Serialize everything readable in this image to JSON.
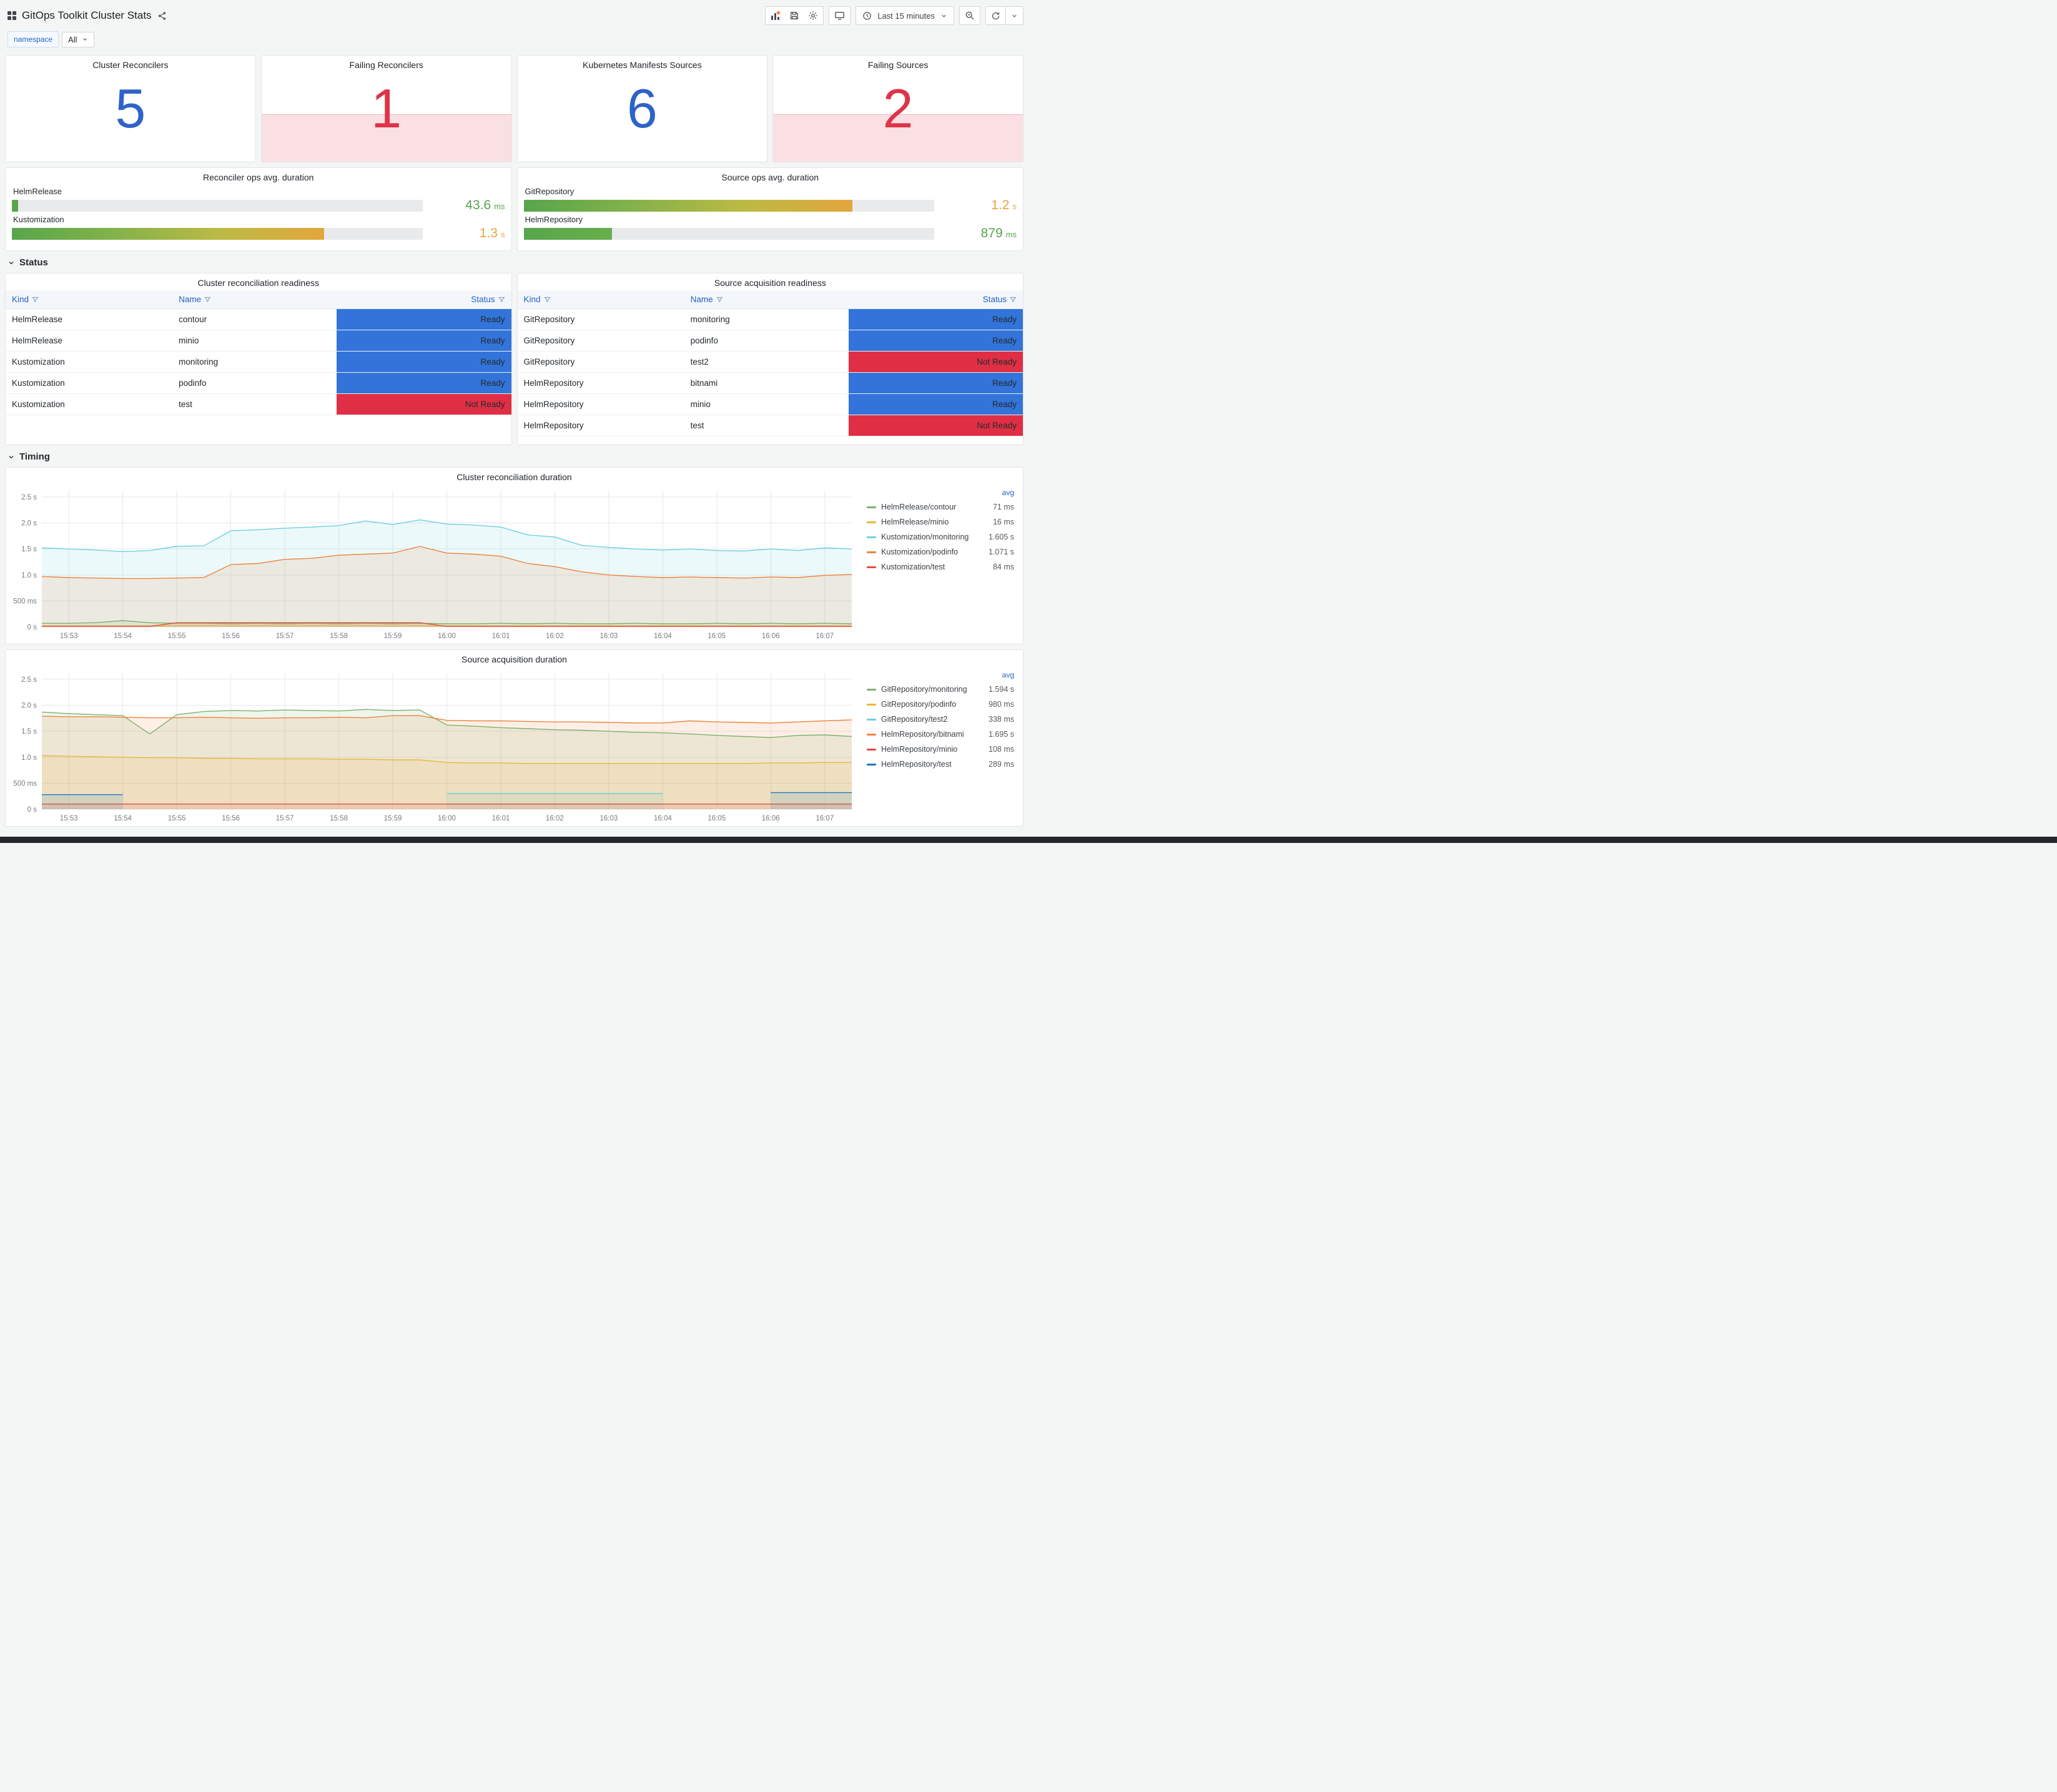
{
  "header": {
    "title": "GitOps Toolkit Cluster Stats",
    "time_range": "Last 15 minutes"
  },
  "variables": {
    "label": "namespace",
    "value": "All"
  },
  "colors": {
    "stat-blue": "#2E63C8",
    "alert-red": "#DE3449",
    "alert-bg": "rgba(224,47,68,0.15)",
    "ready-blue": "#3274D9",
    "notready-red": "#E02F44",
    "link-blue": "#1F62C4",
    "value-green": "#56A64B",
    "value-orange": "#E9A23B"
  },
  "stat_panels": [
    {
      "title": "Cluster Reconcilers",
      "value": "5",
      "state": "normal"
    },
    {
      "title": "Failing Reconcilers",
      "value": "1",
      "state": "alerting"
    },
    {
      "title": "Kubernetes Manifests Sources",
      "value": "6",
      "state": "normal"
    },
    {
      "title": "Failing Sources",
      "value": "2",
      "state": "alerting"
    }
  ],
  "gauge_panels": [
    {
      "title": "Reconciler ops avg. duration",
      "rows": [
        {
          "label": "HelmRelease",
          "value": "43.6",
          "unit": "ms",
          "pct": 1.5,
          "value_color": "#56A64B",
          "bar_colors": [
            "#57A64B",
            "#57A64B"
          ]
        },
        {
          "label": "Kustomization",
          "value": "1.3",
          "unit": "s",
          "pct": 76,
          "value_color": "#E9A23B",
          "bar_colors": [
            "#57A64B",
            "#84B24A",
            "#BCBA44",
            "#E2A63C"
          ]
        }
      ]
    },
    {
      "title": "Source ops avg. duration",
      "rows": [
        {
          "label": "GitRepository",
          "value": "1.2",
          "unit": "s",
          "pct": 80,
          "value_color": "#E9A23B",
          "bar_colors": [
            "#57A64B",
            "#84B24A",
            "#BCBA44",
            "#E2A63C"
          ]
        },
        {
          "label": "HelmRepository",
          "value": "879",
          "unit": "ms",
          "pct": 21.5,
          "value_color": "#56A64B",
          "bar_colors": [
            "#57A64B",
            "#68AE4C"
          ]
        }
      ]
    }
  ],
  "sections": {
    "status": "Status",
    "timing": "Timing"
  },
  "table_panels": [
    {
      "title": "Cluster reconciliation readiness",
      "columns": [
        "Kind",
        "Name",
        "Status"
      ],
      "rows": [
        {
          "kind": "HelmRelease",
          "name": "contour",
          "status": "Ready"
        },
        {
          "kind": "HelmRelease",
          "name": "minio",
          "status": "Ready"
        },
        {
          "kind": "Kustomization",
          "name": "monitoring",
          "status": "Ready"
        },
        {
          "kind": "Kustomization",
          "name": "podinfo",
          "status": "Ready"
        },
        {
          "kind": "Kustomization",
          "name": "test",
          "status": "Not Ready"
        }
      ]
    },
    {
      "title": "Source acquisition readiness",
      "columns": [
        "Kind",
        "Name",
        "Status"
      ],
      "rows": [
        {
          "kind": "GitRepository",
          "name": "monitoring",
          "status": "Ready"
        },
        {
          "kind": "GitRepository",
          "name": "podinfo",
          "status": "Ready"
        },
        {
          "kind": "GitRepository",
          "name": "test2",
          "status": "Not Ready"
        },
        {
          "kind": "HelmRepository",
          "name": "bitnami",
          "status": "Ready"
        },
        {
          "kind": "HelmRepository",
          "name": "minio",
          "status": "Ready"
        },
        {
          "kind": "HelmRepository",
          "name": "test",
          "status": "Not Ready"
        }
      ]
    }
  ],
  "chart_data": [
    {
      "type": "area",
      "title": "Cluster reconciliation duration",
      "legend_header": "avg",
      "ylim": [
        0,
        2.62
      ],
      "xlim": [
        0,
        15
      ],
      "yticks": [
        {
          "v": 0,
          "label": "0 s"
        },
        {
          "v": 0.5,
          "label": "500 ms"
        },
        {
          "v": 1.0,
          "label": "1.0 s"
        },
        {
          "v": 1.5,
          "label": "1.5 s"
        },
        {
          "v": 2.0,
          "label": "2.0 s"
        },
        {
          "v": 2.5,
          "label": "2.5 s"
        }
      ],
      "xticks": [
        {
          "v": 0.5,
          "label": "15:53"
        },
        {
          "v": 1.5,
          "label": "15:54"
        },
        {
          "v": 2.5,
          "label": "15:55"
        },
        {
          "v": 3.5,
          "label": "15:56"
        },
        {
          "v": 4.5,
          "label": "15:57"
        },
        {
          "v": 5.5,
          "label": "15:58"
        },
        {
          "v": 6.5,
          "label": "15:59"
        },
        {
          "v": 7.5,
          "label": "16:00"
        },
        {
          "v": 8.5,
          "label": "16:01"
        },
        {
          "v": 9.5,
          "label": "16:02"
        },
        {
          "v": 10.5,
          "label": "16:03"
        },
        {
          "v": 11.5,
          "label": "16:04"
        },
        {
          "v": 12.5,
          "label": "16:05"
        },
        {
          "v": 13.5,
          "label": "16:06"
        },
        {
          "v": 14.5,
          "label": "16:07"
        }
      ],
      "x": [
        0,
        0.5,
        1,
        1.5,
        2,
        2.5,
        3,
        3.5,
        4,
        4.5,
        5,
        5.5,
        6,
        6.5,
        7,
        7.5,
        8,
        8.5,
        9,
        9.5,
        10,
        10.5,
        11,
        11.5,
        12,
        12.5,
        13,
        13.5,
        14,
        14.5,
        15
      ],
      "series": [
        {
          "name": "HelmRelease/contour",
          "color": "#7EB26D",
          "avg": "71 ms",
          "values": [
            0.07,
            0.07,
            0.08,
            0.12,
            0.08,
            0.07,
            0.07,
            0.06,
            0.07,
            0.06,
            0.07,
            0.06,
            0.07,
            0.06,
            0.07,
            0.06,
            0.06,
            0.07,
            0.06,
            0.07,
            0.06,
            0.06,
            0.07,
            0.06,
            0.06,
            0.07,
            0.06,
            0.07,
            0.06,
            0.07,
            0.06
          ]
        },
        {
          "name": "HelmRelease/minio",
          "color": "#EAB839",
          "avg": "16 ms",
          "values": [
            0.02,
            0.02,
            0.02,
            0.02,
            0.02,
            0.02,
            0.02,
            0.02,
            0.02,
            0.02,
            0.02,
            0.02,
            0.02,
            0.02,
            0.02,
            0.02,
            0.02,
            0.02,
            0.02,
            0.02,
            0.02,
            0.02,
            0.02,
            0.02,
            0.02,
            0.02,
            0.02,
            0.02,
            0.02,
            0.02,
            0.02
          ]
        },
        {
          "name": "Kustomization/monitoring",
          "color": "#6ED0E0",
          "avg": "1.605 s",
          "values": [
            1.52,
            1.5,
            1.48,
            1.45,
            1.47,
            1.55,
            1.56,
            1.85,
            1.87,
            1.9,
            1.92,
            1.95,
            2.04,
            1.97,
            2.06,
            1.98,
            1.96,
            1.92,
            1.77,
            1.73,
            1.57,
            1.53,
            1.5,
            1.48,
            1.5,
            1.47,
            1.46,
            1.5,
            1.47,
            1.52,
            1.5
          ]
        },
        {
          "name": "Kustomization/podinfo",
          "color": "#EF843C",
          "avg": "1.071 s",
          "values": [
            0.97,
            0.95,
            0.94,
            0.93,
            0.93,
            0.94,
            0.95,
            1.2,
            1.22,
            1.3,
            1.32,
            1.38,
            1.4,
            1.42,
            1.55,
            1.42,
            1.4,
            1.36,
            1.22,
            1.16,
            1.06,
            1.0,
            0.97,
            0.95,
            0.96,
            0.95,
            0.94,
            0.96,
            0.95,
            0.99,
            1.01
          ]
        },
        {
          "name": "Kustomization/test",
          "color": "#E24D42",
          "avg": "84 ms",
          "values": [
            0.01,
            0.01,
            0.01,
            0.01,
            0.01,
            0.08,
            0.08,
            0.08,
            0.08,
            0.08,
            0.08,
            0.08,
            0.08,
            0.08,
            0.08,
            0.01,
            0.01,
            0.01,
            0.01,
            0.01,
            0.01,
            0.01,
            0.01,
            0.01,
            0.01,
            0.01,
            0.01,
            0.01,
            0.01,
            0.01,
            0.01
          ]
        }
      ]
    },
    {
      "type": "area",
      "title": "Source acquisition duration",
      "legend_header": "avg",
      "ylim": [
        0,
        2.62
      ],
      "xlim": [
        0,
        15
      ],
      "yticks": [
        {
          "v": 0,
          "label": "0 s"
        },
        {
          "v": 0.5,
          "label": "500 ms"
        },
        {
          "v": 1.0,
          "label": "1.0 s"
        },
        {
          "v": 1.5,
          "label": "1.5 s"
        },
        {
          "v": 2.0,
          "label": "2.0 s"
        },
        {
          "v": 2.5,
          "label": "2.5 s"
        }
      ],
      "xticks": [
        {
          "v": 0.5,
          "label": "15:53"
        },
        {
          "v": 1.5,
          "label": "15:54"
        },
        {
          "v": 2.5,
          "label": "15:55"
        },
        {
          "v": 3.5,
          "label": "15:56"
        },
        {
          "v": 4.5,
          "label": "15:57"
        },
        {
          "v": 5.5,
          "label": "15:58"
        },
        {
          "v": 6.5,
          "label": "15:59"
        },
        {
          "v": 7.5,
          "label": "16:00"
        },
        {
          "v": 8.5,
          "label": "16:01"
        },
        {
          "v": 9.5,
          "label": "16:02"
        },
        {
          "v": 10.5,
          "label": "16:03"
        },
        {
          "v": 11.5,
          "label": "16:04"
        },
        {
          "v": 12.5,
          "label": "16:05"
        },
        {
          "v": 13.5,
          "label": "16:06"
        },
        {
          "v": 14.5,
          "label": "16:07"
        }
      ],
      "x": [
        0,
        0.5,
        1,
        1.5,
        2,
        2.5,
        3,
        3.5,
        4,
        4.5,
        5,
        5.5,
        6,
        6.5,
        7,
        7.5,
        8,
        8.5,
        9,
        9.5,
        10,
        10.5,
        11,
        11.5,
        12,
        12.5,
        13,
        13.5,
        14,
        14.5,
        15
      ],
      "series": [
        {
          "name": "GitRepository/monitoring",
          "color": "#7EB26D",
          "avg": "1.594 s",
          "values": [
            1.87,
            1.84,
            1.82,
            1.8,
            1.45,
            1.82,
            1.88,
            1.9,
            1.89,
            1.91,
            1.9,
            1.89,
            1.92,
            1.9,
            1.91,
            1.62,
            1.6,
            1.57,
            1.55,
            1.53,
            1.52,
            1.5,
            1.48,
            1.47,
            1.45,
            1.42,
            1.4,
            1.38,
            1.42,
            1.43,
            1.4
          ]
        },
        {
          "name": "GitRepository/podinfo",
          "color": "#EAB839",
          "avg": "980 ms",
          "values": [
            1.03,
            1.02,
            1.01,
            1.0,
            0.99,
            0.99,
            0.98,
            0.98,
            0.97,
            0.97,
            0.97,
            0.96,
            0.96,
            0.95,
            0.95,
            0.9,
            0.89,
            0.89,
            0.88,
            0.88,
            0.88,
            0.88,
            0.88,
            0.88,
            0.88,
            0.88,
            0.88,
            0.89,
            0.89,
            0.9,
            0.9
          ]
        },
        {
          "name": "GitRepository/test2",
          "color": "#6ED0E0",
          "avg": "338 ms",
          "values": [
            null,
            null,
            null,
            null,
            null,
            null,
            null,
            null,
            null,
            null,
            null,
            null,
            null,
            null,
            null,
            0.3,
            0.3,
            0.3,
            0.3,
            0.3,
            0.3,
            0.3,
            0.3,
            0.3,
            null,
            null,
            null,
            null,
            null,
            null,
            null
          ]
        },
        {
          "name": "HelmRepository/bitnami",
          "color": "#EF843C",
          "avg": "1.695 s",
          "values": [
            1.79,
            1.78,
            1.78,
            1.77,
            1.76,
            1.76,
            1.77,
            1.76,
            1.75,
            1.76,
            1.76,
            1.77,
            1.76,
            1.8,
            1.8,
            1.71,
            1.7,
            1.7,
            1.69,
            1.68,
            1.68,
            1.67,
            1.66,
            1.66,
            1.7,
            1.68,
            1.67,
            1.66,
            1.68,
            1.7,
            1.72
          ]
        },
        {
          "name": "HelmRepository/minio",
          "color": "#E24D42",
          "avg": "108 ms",
          "values": [
            0.1,
            0.1,
            0.1,
            0.1,
            0.1,
            0.1,
            0.1,
            0.1,
            0.1,
            0.1,
            0.1,
            0.1,
            0.1,
            0.1,
            0.1,
            0.1,
            0.1,
            0.1,
            0.1,
            0.1,
            0.1,
            0.1,
            0.1,
            0.1,
            0.1,
            0.1,
            0.1,
            0.1,
            0.1,
            0.1,
            0.1
          ]
        },
        {
          "name": "HelmRepository/test",
          "color": "#1F78C1",
          "avg": "289 ms",
          "values": [
            0.28,
            0.28,
            0.28,
            0.28,
            null,
            null,
            null,
            null,
            null,
            null,
            null,
            null,
            null,
            null,
            null,
            null,
            null,
            null,
            null,
            null,
            null,
            null,
            null,
            null,
            null,
            null,
            null,
            0.32,
            0.32,
            0.32,
            0.32
          ]
        }
      ]
    }
  ]
}
